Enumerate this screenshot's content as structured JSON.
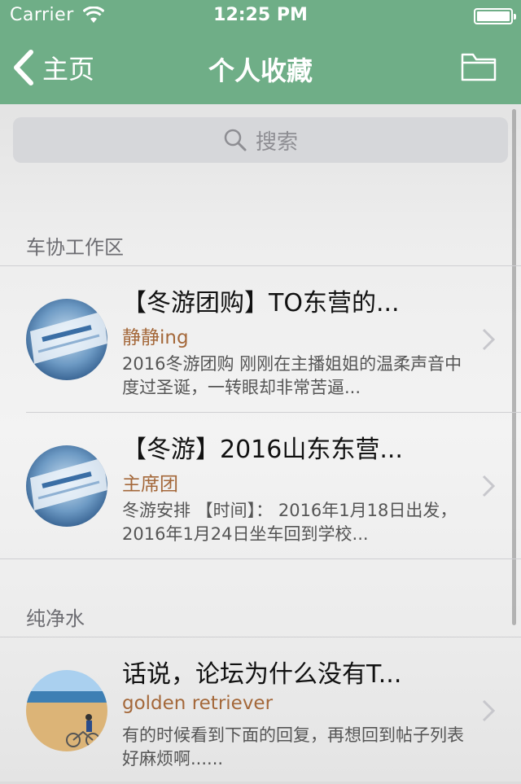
{
  "status": {
    "carrier": "Carrier",
    "time": "12:25 PM"
  },
  "nav": {
    "back_label": "主页",
    "title": "个人收藏"
  },
  "search": {
    "placeholder": "搜索"
  },
  "sections": [
    {
      "header": "车协工作区",
      "items": [
        {
          "title": "【冬游团购】TO东营的...",
          "author": "静静ing",
          "snippet": "2016冬游团购 刚刚在主播姐姐的温柔声音中度过圣诞，一转眼却非常苦逼..."
        },
        {
          "title": "【冬游】2016山东东营...",
          "author": "主席团",
          "snippet": "冬游安排 【时间】： 2016年1月18日出发，2016年1月24日坐车回到学校..."
        }
      ]
    },
    {
      "header": "纯净水",
      "items": [
        {
          "title": "话说，论坛为什么没有T...",
          "author": "golden retriever",
          "snippet": "有的时候看到下面的回复，再想回到帖子列表好麻烦啊......"
        }
      ]
    }
  ],
  "colors": {
    "nav_bg": "#6fae87",
    "author": "#a4683a"
  },
  "icons": {
    "back": "chevron-left-icon",
    "folder": "folder-icon",
    "search": "search-icon",
    "disclosure": "chevron-right-icon"
  }
}
